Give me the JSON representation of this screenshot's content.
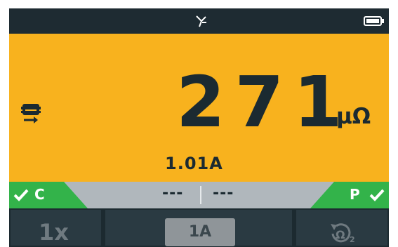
{
  "colors": {
    "display_background": "#f8b21e",
    "status_ok": "#33b34a",
    "dark": "#1c2a30"
  },
  "topbar": {
    "connection_icon": "bluetooth-icon",
    "battery_icon": "battery-icon"
  },
  "measurement": {
    "mode_icon": "probe-icon",
    "value": "271",
    "unit": "µΩ",
    "current": "1.01A"
  },
  "status": {
    "left_label": "C",
    "right_label": "P",
    "reading_left": "---",
    "reading_right": "---"
  },
  "softkeys": {
    "left_label": "1x",
    "middle_label": "1A",
    "right_icon": "reset-icon"
  }
}
